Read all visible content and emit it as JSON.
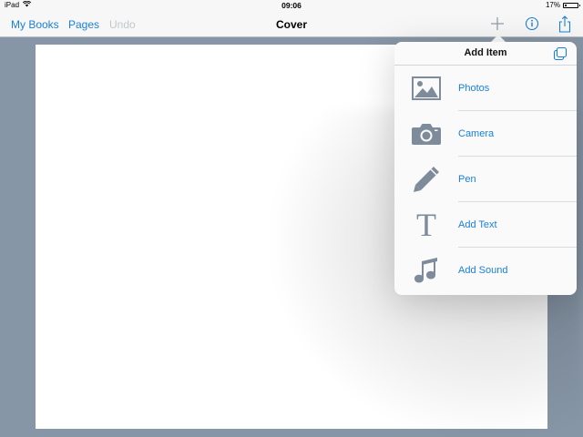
{
  "status_bar": {
    "device": "iPad",
    "time": "09:06",
    "battery": "17%",
    "battery_level": 0.17,
    "icons": [
      "wifi-icon",
      "battery-icon"
    ]
  },
  "navbar": {
    "my_books": "My Books",
    "pages": "Pages",
    "undo": "Undo",
    "title": "Cover",
    "icons": [
      "plus-icon",
      "info-icon",
      "share-icon"
    ]
  },
  "popover": {
    "title": "Add Item",
    "header_icon": "duplicate-icon",
    "items": [
      {
        "label": "Photos",
        "icon": "photo-icon"
      },
      {
        "label": "Camera",
        "icon": "camera-icon"
      },
      {
        "label": "Pen",
        "icon": "pen-icon"
      },
      {
        "label": "Add Text",
        "icon": "text-icon",
        "glyph": "T"
      },
      {
        "label": "Add Sound",
        "icon": "music-note-icon"
      }
    ]
  },
  "colors": {
    "accent": "#1a7fd9",
    "disabled": "#c3c6ca",
    "icon_gray": "#7d8b9b",
    "background": "#8796a6"
  }
}
